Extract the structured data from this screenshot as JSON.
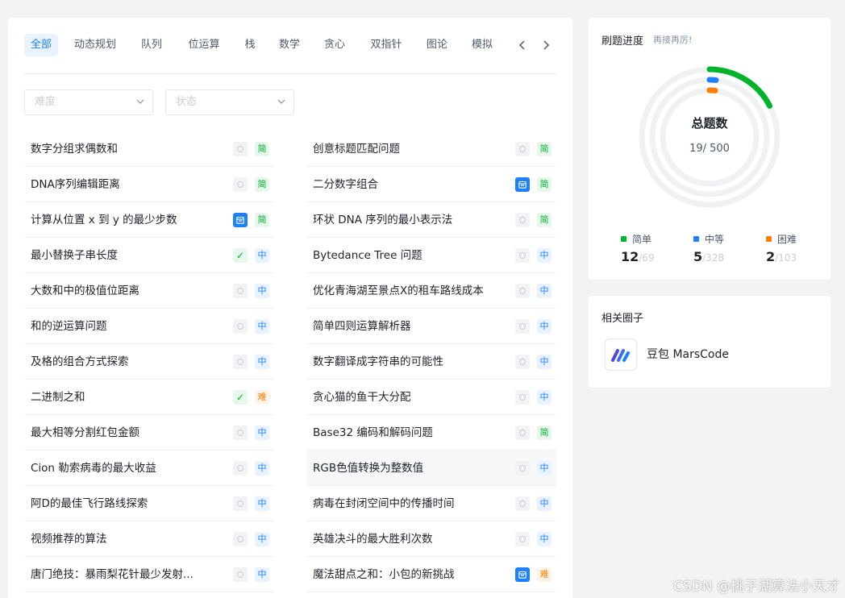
{
  "tabs": {
    "items": [
      "全部",
      "动态规划",
      "队列",
      "位运算",
      "栈",
      "数学",
      "贪心",
      "双指针",
      "图论",
      "模拟"
    ],
    "prev_icon": "chevron-left-icon",
    "next_icon": "chevron-right-icon",
    "active_color": "#1e80ff"
  },
  "filters": {
    "difficulty_placeholder": "难度",
    "status_placeholder": "状态"
  },
  "difficulty_labels": {
    "easy": "简",
    "medium": "中",
    "hard": "难"
  },
  "status_icons": {
    "todo": "circle-icon",
    "done": "check-icon",
    "scheduled": "calendar-icon"
  },
  "questions_left": [
    {
      "title": "数字分组求偶数和",
      "status": "todo",
      "difficulty": "easy"
    },
    {
      "title": "DNA序列编辑距离",
      "status": "todo",
      "difficulty": "easy"
    },
    {
      "title": "计算从位置 x 到 y 的最少步数",
      "status": "scheduled",
      "difficulty": "easy"
    },
    {
      "title": "最小替换子串长度",
      "status": "done",
      "difficulty": "medium"
    },
    {
      "title": "大数和中的极值位距离",
      "status": "todo",
      "difficulty": "medium"
    },
    {
      "title": "和的逆运算问题",
      "status": "todo",
      "difficulty": "medium"
    },
    {
      "title": "及格的组合方式探索",
      "status": "todo",
      "difficulty": "medium"
    },
    {
      "title": "二进制之和",
      "status": "done",
      "difficulty": "hard"
    },
    {
      "title": "最大相等分割红包金额",
      "status": "todo",
      "difficulty": "medium"
    },
    {
      "title": "Cion 勒索病毒的最大收益",
      "status": "todo",
      "difficulty": "medium"
    },
    {
      "title": "阿D的最佳飞行路线探索",
      "status": "todo",
      "difficulty": "medium"
    },
    {
      "title": "视频推荐的算法",
      "status": "todo",
      "difficulty": "medium"
    },
    {
      "title": "唐门绝技：暴雨梨花针最少发射...",
      "status": "todo",
      "difficulty": "medium"
    }
  ],
  "questions_right": [
    {
      "title": "创意标题匹配问题",
      "status": "todo",
      "difficulty": "easy"
    },
    {
      "title": "二分数字组合",
      "status": "scheduled",
      "difficulty": "easy"
    },
    {
      "title": "环状 DNA 序列的最小表示法",
      "status": "todo",
      "difficulty": "easy"
    },
    {
      "title": "Bytedance Tree 问题",
      "status": "todo",
      "difficulty": "medium"
    },
    {
      "title": "优化青海湖至景点X的租车路线成本",
      "status": "todo",
      "difficulty": "medium"
    },
    {
      "title": "简单四则运算解析器",
      "status": "todo",
      "difficulty": "medium"
    },
    {
      "title": "数字翻译成字符串的可能性",
      "status": "todo",
      "difficulty": "medium"
    },
    {
      "title": "贪心猫的鱼干大分配",
      "status": "todo",
      "difficulty": "medium"
    },
    {
      "title": "Base32 编码和解码问题",
      "status": "todo",
      "difficulty": "easy"
    },
    {
      "title": "RGB色值转换为整数值",
      "status": "todo",
      "difficulty": "medium",
      "highlighted": true
    },
    {
      "title": "病毒在封闭空间中的传播时间",
      "status": "todo",
      "difficulty": "medium"
    },
    {
      "title": "英雄决斗的最大胜利次数",
      "status": "todo",
      "difficulty": "medium"
    },
    {
      "title": "魔法甜点之和：小包的新挑战",
      "status": "scheduled",
      "difficulty": "hard"
    }
  ],
  "progress": {
    "title": "刷题进度",
    "subtitle": "再接再厉!",
    "center_label": "总题数",
    "solved": 19,
    "total_label": "19/ 500",
    "total": 500,
    "levels": [
      {
        "name": "简单",
        "solved": "12",
        "total": "/69",
        "color": "#00b42a",
        "fraction": 0.1739
      },
      {
        "name": "中等",
        "solved": "5",
        "total": "/328",
        "color": "#1e80ff",
        "fraction": 0.0152
      },
      {
        "name": "困难",
        "solved": "2",
        "total": "/103",
        "color": "#ff7d00",
        "fraction": 0.0194
      }
    ]
  },
  "circle": {
    "title": "相关圈子",
    "name": "豆包 MarsCode",
    "logo_icon": "marscode-logo-icon"
  },
  "watermark": "CSDN @桃子湖算法小天才"
}
